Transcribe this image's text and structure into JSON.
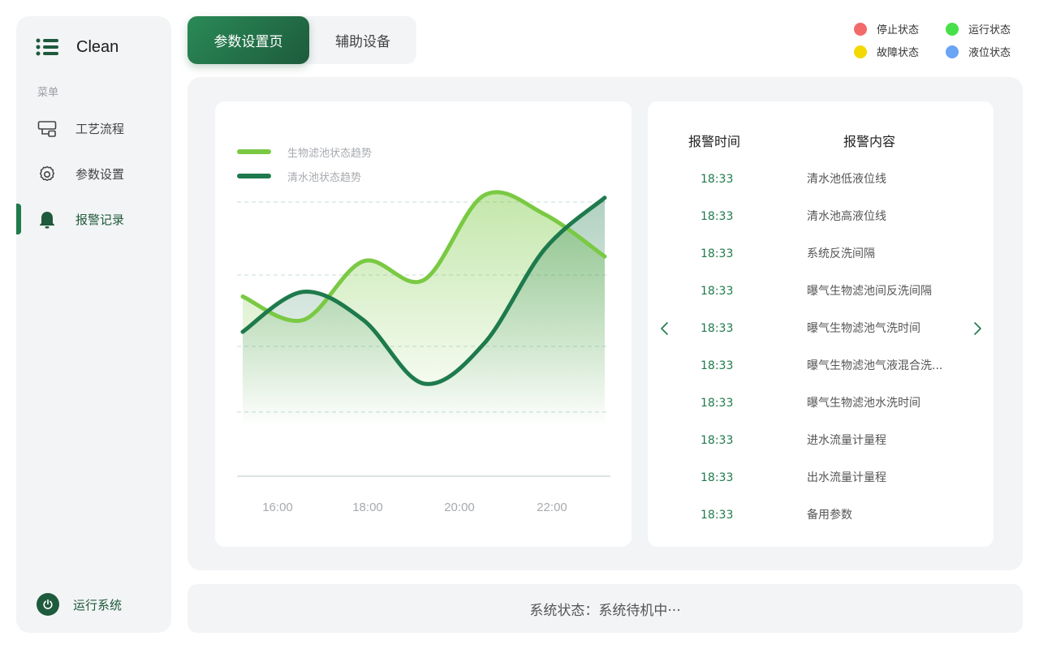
{
  "app": {
    "brand": "Clean",
    "menu_caption": "菜单",
    "nav": [
      {
        "label": "工艺流程",
        "icon": "process-flow-icon",
        "active": false
      },
      {
        "label": "参数设置",
        "icon": "gear-icon",
        "active": false
      },
      {
        "label": "报警记录",
        "icon": "bell-icon",
        "active": true
      }
    ],
    "run_system": "运行系统"
  },
  "tabs": {
    "active": "参数设置页",
    "inactive": "辅助设备"
  },
  "status_legend": [
    {
      "label": "停止状态",
      "color": "#f26a6a"
    },
    {
      "label": "运行状态",
      "color": "#47e04a"
    },
    {
      "label": "故障状态",
      "color": "#f2d900"
    },
    {
      "label": "液位状态",
      "color": "#6aa4f5"
    }
  ],
  "chart_data": {
    "type": "line",
    "x": [
      "16:00",
      "18:00",
      "20:00",
      "22:00"
    ],
    "series": [
      {
        "name": "生物滤池状态趋势",
        "color": "#7ac943",
        "values": [
          0.55,
          0.45,
          0.7,
          0.62,
          0.98,
          0.9,
          0.72
        ]
      },
      {
        "name": "清水池状态趋势",
        "color": "#1e7a4c",
        "values": [
          0.4,
          0.57,
          0.45,
          0.18,
          0.35,
          0.75,
          0.97
        ]
      }
    ],
    "grid": true,
    "xlabel": "",
    "ylabel": ""
  },
  "alarms": {
    "header_time": "报警时间",
    "header_content": "报警内容",
    "rows": [
      {
        "time": "18:33",
        "content": "清水池低液位线"
      },
      {
        "time": "18:33",
        "content": "清水池高液位线"
      },
      {
        "time": "18:33",
        "content": "系统反洗间隔"
      },
      {
        "time": "18:33",
        "content": "曝气生物滤池间反洗间隔"
      },
      {
        "time": "18:33",
        "content": "曝气生物滤池气洗时间"
      },
      {
        "time": "18:33",
        "content": "曝气生物滤池气液混合洗..."
      },
      {
        "time": "18:33",
        "content": "曝气生物滤池水洗时间"
      },
      {
        "time": "18:33",
        "content": "进水流量计量程"
      },
      {
        "time": "18:33",
        "content": "出水流量计量程"
      },
      {
        "time": "18:33",
        "content": "备用参数"
      }
    ]
  },
  "status_bar": "系统状态：系统待机中···"
}
